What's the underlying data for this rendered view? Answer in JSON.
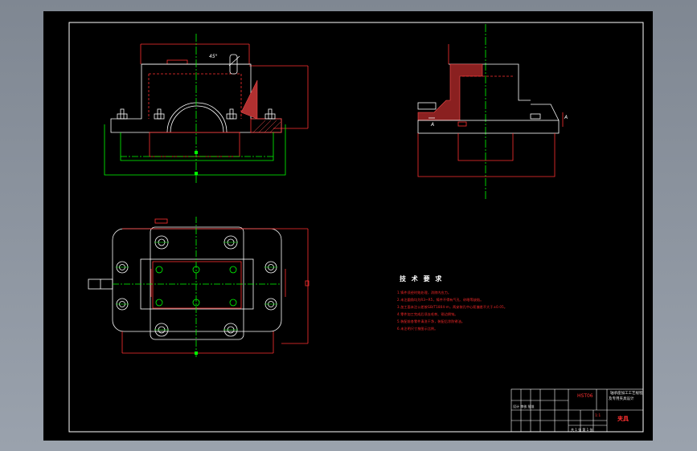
{
  "views": {
    "front_angle": "45°",
    "section_mark": "A"
  },
  "tech_req": {
    "title": "技 术 要 求",
    "items": [
      "1.铸件须经时效处理，消除内应力。",
      "2.未注圆角均为R3~R5，铸件不得有气孔、砂眼等缺陷。",
      "3.加工面未注公差按GB/T1804-m，两安装孔中心距偏差不大于±0.05。",
      "4.零件加工完成后须去毛刺、锐边倒钝。",
      "5.装配前各零件清洗干净，装配后涂防锈油。",
      "6.未注明尺寸按图示比例。"
    ]
  },
  "title_block": {
    "drawing_no": "HST06",
    "title_line1": "轴承座加工工艺规程",
    "title_line2": "及专用夹具设计",
    "part_name": "夹具",
    "sign_marks": "设计 审核 批准",
    "sheet_info": "共 1 张  第 1 张",
    "scale": "1:1"
  }
}
